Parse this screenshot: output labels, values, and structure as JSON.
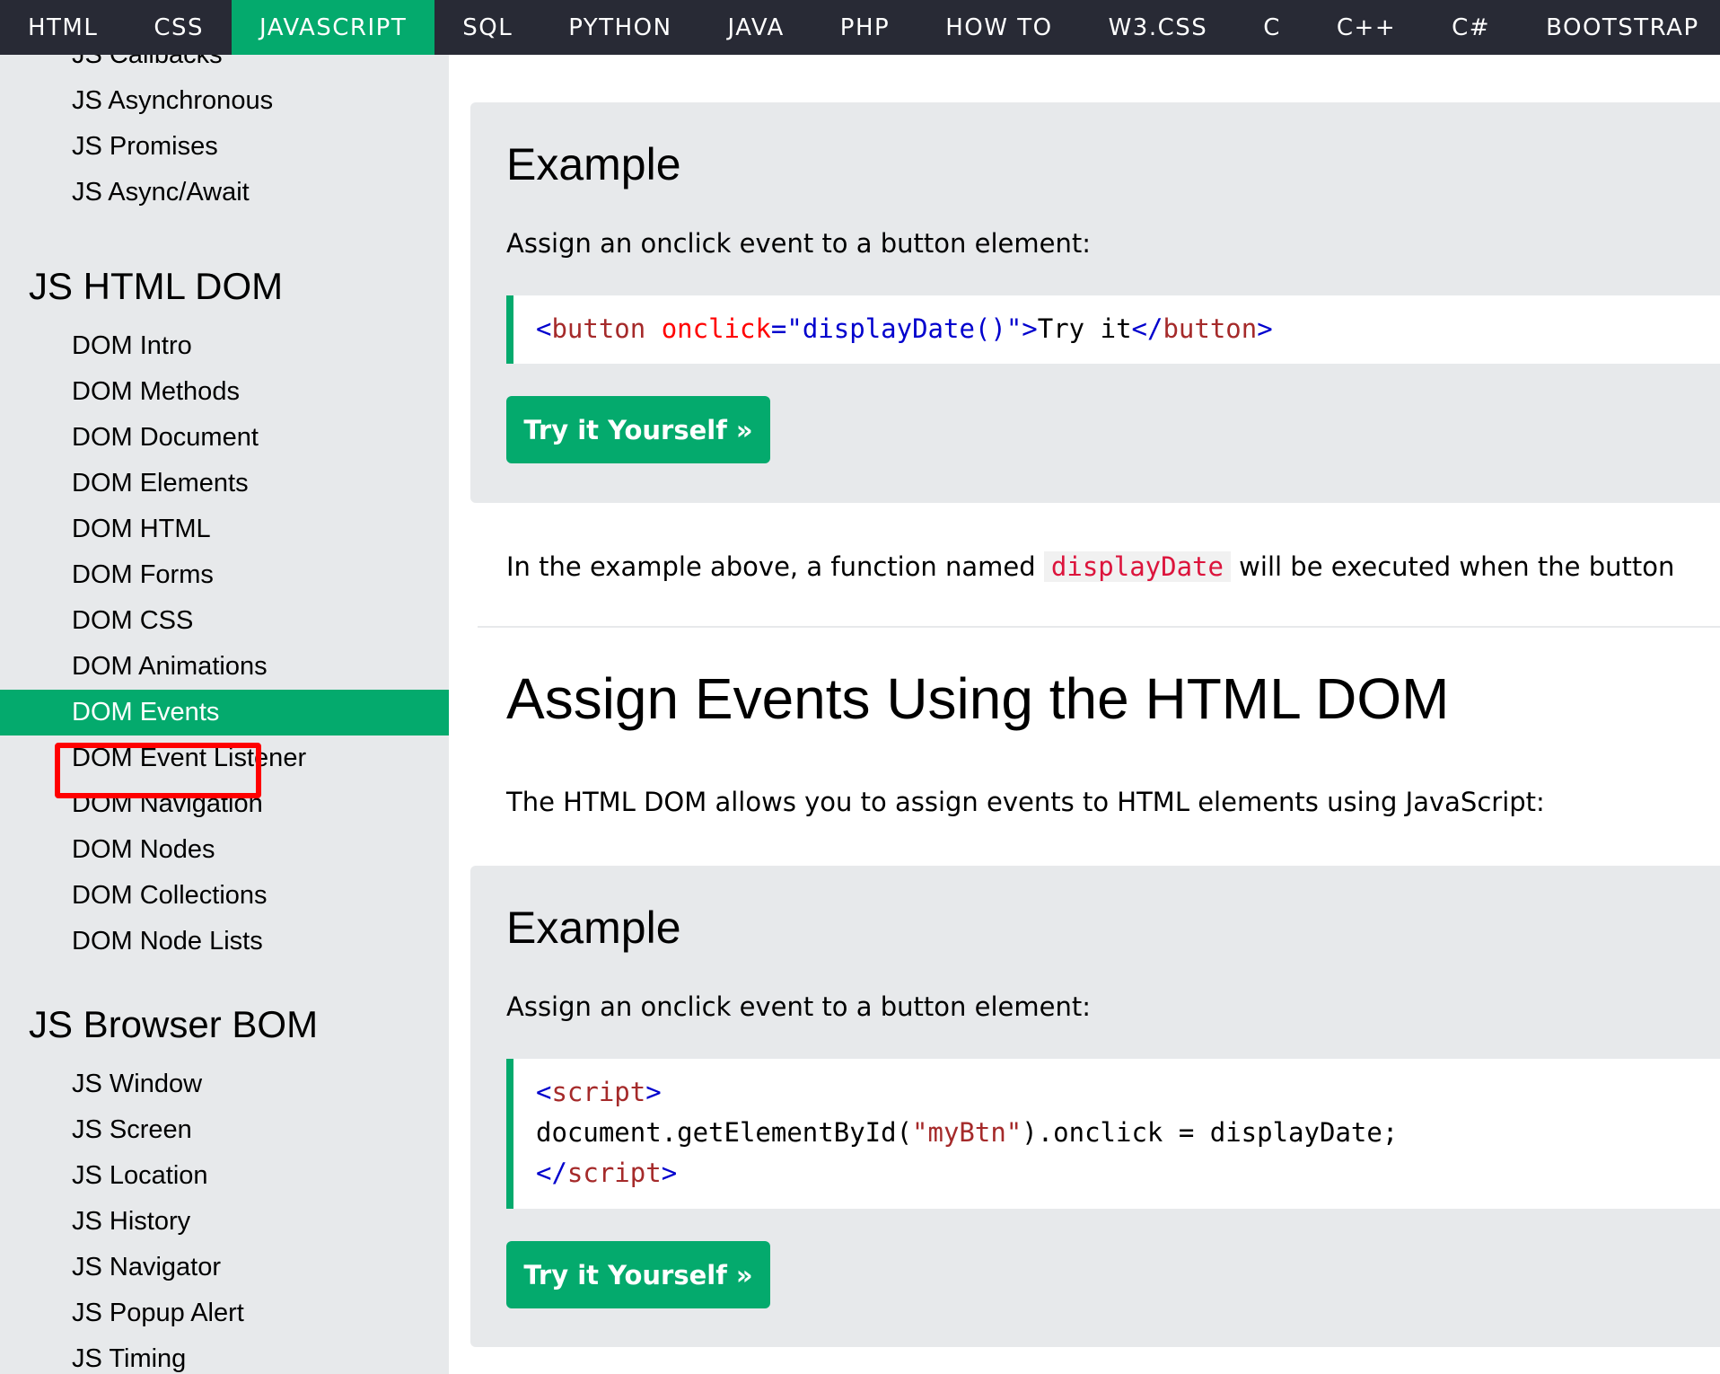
{
  "topnav": {
    "items": [
      "HTML",
      "CSS",
      "JAVASCRIPT",
      "SQL",
      "PYTHON",
      "JAVA",
      "PHP",
      "HOW TO",
      "W3.CSS",
      "C",
      "C++",
      "C#",
      "BOOTSTRAP"
    ],
    "active": "JAVASCRIPT"
  },
  "sidebar": {
    "async_items": [
      "JS Callbacks",
      "JS Asynchronous",
      "JS Promises",
      "JS Async/Await"
    ],
    "dom_heading": "JS HTML DOM",
    "dom_items": [
      "DOM Intro",
      "DOM Methods",
      "DOM Document",
      "DOM Elements",
      "DOM HTML",
      "DOM Forms",
      "DOM CSS",
      "DOM Animations",
      "DOM Events",
      "DOM Event Listener",
      "DOM Navigation",
      "DOM Nodes",
      "DOM Collections",
      "DOM Node Lists"
    ],
    "active_item": "DOM Events",
    "bom_heading": "JS Browser BOM",
    "bom_items": [
      "JS Window",
      "JS Screen",
      "JS Location",
      "JS History",
      "JS Navigator",
      "JS Popup Alert",
      "JS Timing"
    ]
  },
  "example1": {
    "title": "Example",
    "description": "Assign an onclick event to a button element:",
    "code": {
      "tag_open": "<",
      "tag_name": "button",
      "attr_name": " onclick",
      "equals": "=",
      "attr_value": "\"displayDate()\"",
      "tag_close": ">",
      "text": "Try it",
      "end_open": "</",
      "end_name": "button",
      "end_close": ">"
    },
    "button_label": "Try it Yourself »"
  },
  "explanation": {
    "before": "In the example above, a function named ",
    "code": "displayDate",
    "after": " will be executed when the button"
  },
  "section": {
    "title": "Assign Events Using the HTML DOM",
    "intro": "The HTML DOM allows you to assign events to HTML elements using JavaScript:"
  },
  "example2": {
    "title": "Example",
    "description": "Assign an onclick event to a button element:",
    "code": {
      "l1_open": "<",
      "l1_name": "script",
      "l1_close": ">",
      "l2_a": "document.getElementById(",
      "l2_str": "\"myBtn\"",
      "l2_b": ").onclick = displayDate;",
      "l3_open": "</",
      "l3_name": "script",
      "l3_close": ">"
    },
    "button_label": "Try it Yourself »"
  },
  "colors": {
    "accent": "#04AA6D",
    "topnav_bg": "#282A35",
    "sidebar_bg": "#E7E9EB",
    "highlight": "#FF0000"
  }
}
